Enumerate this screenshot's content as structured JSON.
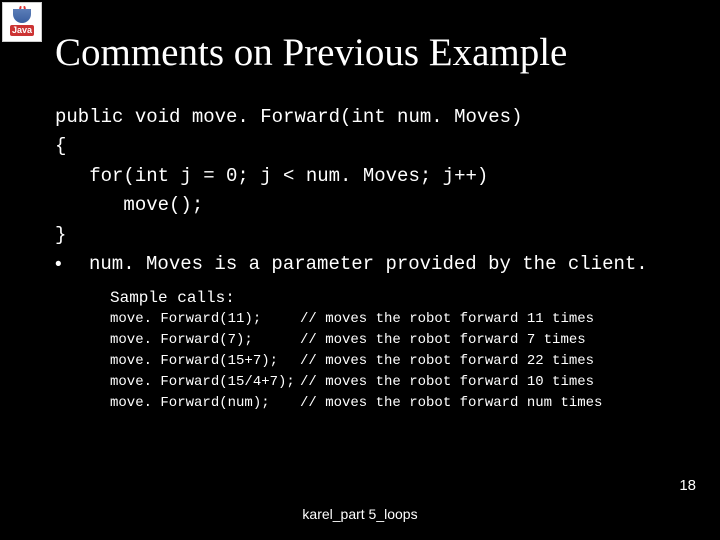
{
  "logo": {
    "wordmark": "Java"
  },
  "title": "Comments on Previous Example",
  "code": {
    "l1": "public void move. Forward(int num. Moves)",
    "l2": "{",
    "l3": "   for(int j = 0; j < num. Moves; j++)",
    "l4": "      move();",
    "l5": "}"
  },
  "bullet": "num. Moves is a parameter provided by the client.",
  "samples_label": "Sample calls:",
  "samples": [
    {
      "call": "move. Forward(11);",
      "comment": "// moves the robot forward 11 times"
    },
    {
      "call": "move. Forward(7);",
      "comment": "// moves the robot forward 7 times"
    },
    {
      "call": "move. Forward(15+7);",
      "comment": "// moves the robot forward 22 times"
    },
    {
      "call": "move. Forward(15/4+7);",
      "comment": "// moves the robot forward 10 times"
    },
    {
      "call": "move. Forward(num);",
      "comment": "// moves the robot forward num times"
    }
  ],
  "footer": "karel_part 5_loops",
  "page": "18"
}
